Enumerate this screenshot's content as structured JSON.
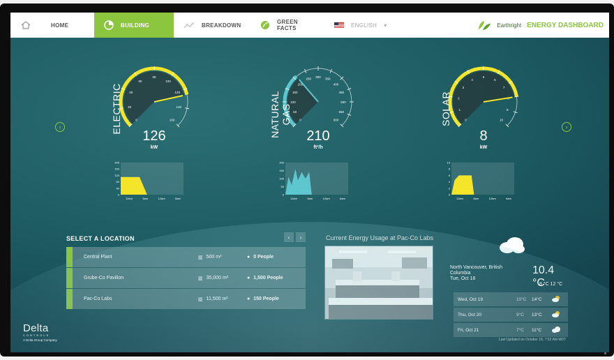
{
  "nav": {
    "home_label": "HOME",
    "building_label": "BUILDING",
    "breakdown_label": "BREAKDOWN",
    "green_facts_label": "GREEN FACTS",
    "language_label": "ENGLISH",
    "brand_label": "Earthright",
    "dashboard_label": "ENERGY DASHBOARD"
  },
  "gauges": [
    {
      "label": "ELECTRIC",
      "value": "126",
      "unit": "kW",
      "max": 160,
      "reading": 126,
      "ticks": [
        "0",
        "20",
        "40",
        "60",
        "80",
        "100",
        "120",
        "140",
        "160"
      ],
      "color": "#f5e52a",
      "chart": {
        "y_ticks": [
          "200",
          "160",
          "120",
          "80",
          "40",
          "0"
        ],
        "x_ticks": [
          "12am",
          "6am",
          "12am",
          "6am"
        ]
      }
    },
    {
      "label": "NATURAL GAS",
      "value": "210",
      "unit": "ft³/h",
      "max": 600,
      "reading": 210,
      "ticks": [
        "0",
        "50",
        "100",
        "150",
        "200",
        "250",
        "300",
        "350",
        "400",
        "450",
        "500",
        "550",
        "600"
      ],
      "color": "#5ec6cf",
      "chart": {
        "y_ticks": [
          "200",
          "150",
          "100",
          "50",
          "0"
        ],
        "x_ticks": [
          "12am",
          "6am",
          "12am",
          "6am"
        ]
      }
    },
    {
      "label": "SOLAR",
      "value": "8",
      "unit": "kW",
      "max": 10,
      "reading": 8,
      "ticks": [
        "0",
        "1",
        "2",
        "3",
        "4",
        "5",
        "6",
        "7",
        "8",
        "9",
        "10"
      ],
      "color": "#f5e52a",
      "chart": {
        "y_ticks": [
          "10",
          "8",
          "6",
          "4",
          "2",
          "0"
        ],
        "x_ticks": [
          "12am",
          "6am",
          "12am",
          "6am"
        ]
      }
    }
  ],
  "locations": {
    "title": "SELECT A LOCATION",
    "items": [
      {
        "name": "Central Plant",
        "area": "500 m²",
        "people": "0 People"
      },
      {
        "name": "Grube-Co Pavilion",
        "area": "35,000 m²",
        "people": "1,500 People"
      },
      {
        "name": "Pac-Co Labs",
        "area": "11,500 m²",
        "people": "150 People"
      }
    ]
  },
  "current": {
    "title": "Current Energy Usage at Pac-Co Labs"
  },
  "weather": {
    "location": "North Vancouver, British Columbia",
    "date": "Tue, Oct 18",
    "temp": "10.4 °C",
    "range": "8 °C  12 °C",
    "forecast": [
      {
        "day": "Wed, Oct 19",
        "low": "10°C",
        "high": "14°C",
        "icon": "sun-cloud-icon"
      },
      {
        "day": "Thu, Oct 20",
        "low": "9°C",
        "high": "13°C",
        "icon": "sun-cloud-icon"
      },
      {
        "day": "Fri, Oct 21",
        "low": "7°C",
        "high": "11°C",
        "icon": "cloud-icon"
      }
    ],
    "updated": "Last Updated on October 18, 7:52 AM MDT"
  },
  "footer_logo": {
    "word": "Delta",
    "sub": "CONTROLS",
    "company": "A Delta Group Company"
  },
  "colors": {
    "accent": "#8cc63f",
    "yellow": "#f5e52a",
    "cyan": "#5ec6cf"
  }
}
